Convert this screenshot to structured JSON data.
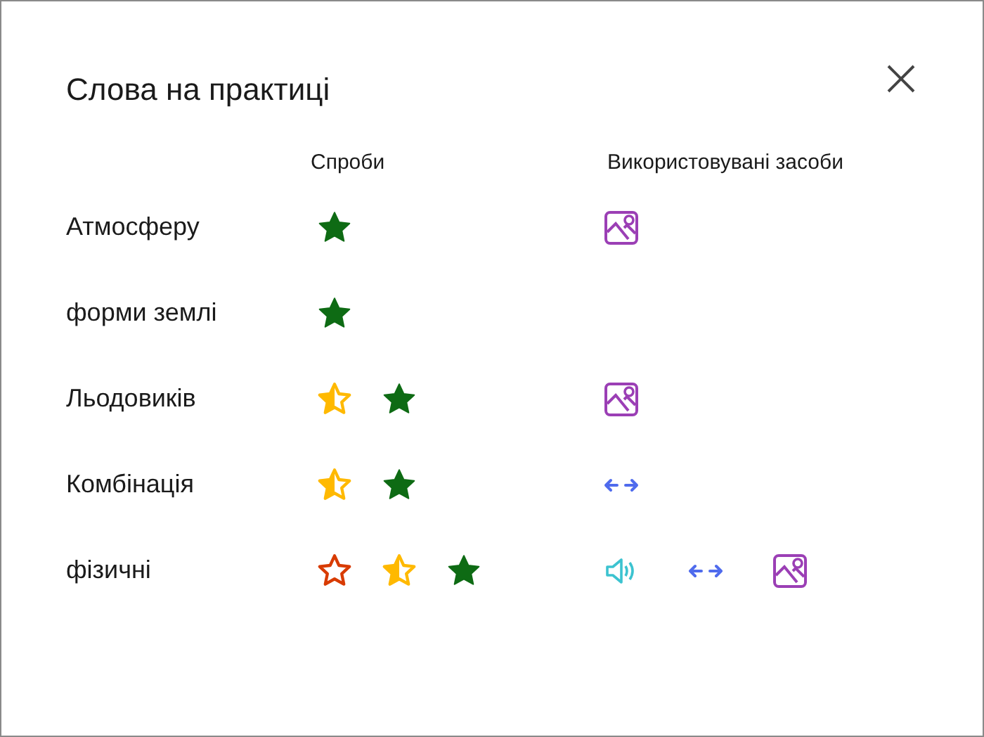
{
  "dialog": {
    "title": "Слова на практиці"
  },
  "columns": [
    "Спроби",
    "Використовувані засоби"
  ],
  "rows": [
    {
      "word": "Атмосферу",
      "attempts": [
        {
          "kind": "full"
        }
      ],
      "tools": [
        {
          "kind": "image"
        }
      ]
    },
    {
      "word": "форми землі",
      "attempts": [
        {
          "kind": "full"
        }
      ],
      "tools": []
    },
    {
      "word": "Льодовиків",
      "attempts": [
        {
          "kind": "half"
        },
        {
          "kind": "full"
        }
      ],
      "tools": [
        {
          "kind": "image"
        }
      ]
    },
    {
      "word": "Комбінація",
      "attempts": [
        {
          "kind": "half"
        },
        {
          "kind": "full"
        }
      ],
      "tools": [
        {
          "kind": "syllables"
        }
      ]
    },
    {
      "word": "фізичні",
      "attempts": [
        {
          "kind": "wrong"
        },
        {
          "kind": "half"
        },
        {
          "kind": "full"
        }
      ],
      "tools": [
        {
          "kind": "audio"
        },
        {
          "kind": "syllables"
        },
        {
          "kind": "image"
        }
      ]
    }
  ]
}
